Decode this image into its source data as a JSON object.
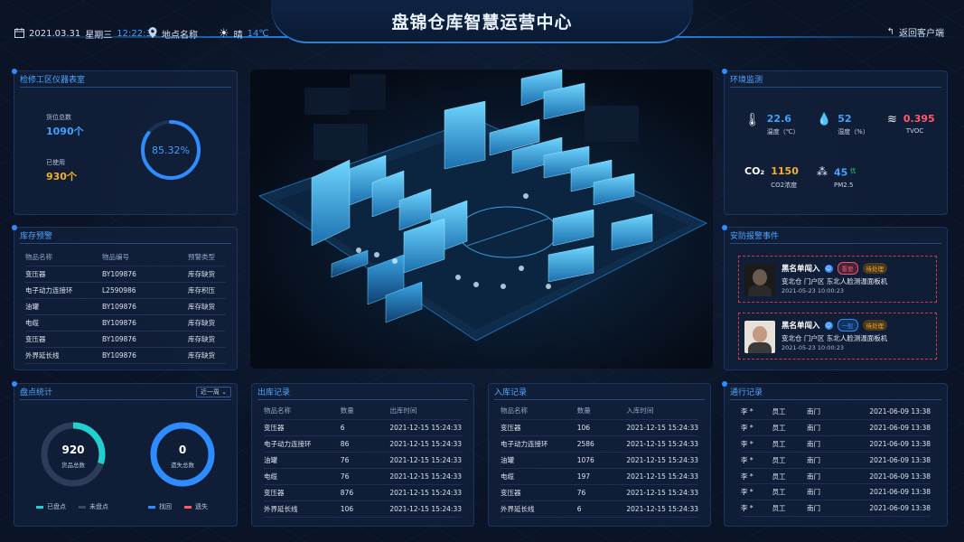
{
  "header": {
    "title": "盘锦仓库智慧运营中心",
    "date": "2021.03.31",
    "weekday": "星期三",
    "time": "12:22:31",
    "location": "地点名称",
    "weather": "晴",
    "temperature": "14℃",
    "back_label": "返回客户端"
  },
  "instrument": {
    "title": "检修工区仪器表室",
    "total_label": "货位总数",
    "total_value": "1090个",
    "used_label": "已使用",
    "used_value": "930个",
    "percent": "85.32%",
    "ratio": 0.8532
  },
  "stock_alert": {
    "title": "库存预警",
    "columns": [
      "物品名称",
      "物品编号",
      "预警类型"
    ],
    "rows": [
      [
        "变压器",
        "BY109876",
        "库存缺货"
      ],
      [
        "电子动力连接环",
        "L2590986",
        "库存积压"
      ],
      [
        "油罐",
        "BY109876",
        "库存缺货"
      ],
      [
        "电缆",
        "BY109876",
        "库存缺货"
      ],
      [
        "变压器",
        "BY109876",
        "库存缺货"
      ],
      [
        "外界延长线",
        "BY109876",
        "库存缺货"
      ]
    ]
  },
  "inventory": {
    "title": "盘点统计",
    "period": "近一周",
    "total": "920",
    "total_label": "货品总数",
    "lost": "0",
    "lost_label": "遗失总数",
    "checked_ratio": 0.3,
    "legend": [
      "已盘点",
      "未盘点",
      "找回",
      "遗失"
    ],
    "colors": [
      "#1fd0cf",
      "#3a4a66",
      "#2f8cff",
      "#ff5a6a"
    ]
  },
  "outbound": {
    "title": "出库记录",
    "columns": [
      "物品名称",
      "数量",
      "出库时间"
    ],
    "rows": [
      [
        "变压器",
        "6",
        "2021-12-15 15:24:33"
      ],
      [
        "电子动力连接环",
        "86",
        "2021-12-15 15:24:33"
      ],
      [
        "油罐",
        "76",
        "2021-12-15 15:24:33"
      ],
      [
        "电缆",
        "76",
        "2021-12-15 15:24:33"
      ],
      [
        "变压器",
        "876",
        "2021-12-15 15:24:33"
      ],
      [
        "外界延长线",
        "106",
        "2021-12-15 15:24:33"
      ]
    ]
  },
  "inbound": {
    "title": "入库记录",
    "columns": [
      "物品名称",
      "数量",
      "入库时间"
    ],
    "rows": [
      [
        "变压器",
        "106",
        "2021-12-15 15:24:33"
      ],
      [
        "电子动力连接环",
        "2586",
        "2021-12-15 15:24:33"
      ],
      [
        "油罐",
        "1076",
        "2021-12-15 15:24:33"
      ],
      [
        "电缆",
        "197",
        "2021-12-15 15:24:33"
      ],
      [
        "变压器",
        "76",
        "2021-12-15 15:24:33"
      ],
      [
        "外界延长线",
        "6",
        "2021-12-15 15:24:33"
      ]
    ]
  },
  "environment": {
    "title": "环境监测",
    "temp": {
      "value": "22.6",
      "label": "温度（℃）"
    },
    "humidity": {
      "value": "52",
      "label": "湿度（%）"
    },
    "tvoc": {
      "value": "0.395",
      "label": "TVOC"
    },
    "co2": {
      "value": "1150",
      "label": "CO2浓度",
      "icon": "CO₂"
    },
    "pm": {
      "value": "45",
      "grade": "优",
      "label": "PM2.5"
    }
  },
  "security": {
    "title": "安防报警事件",
    "events": [
      {
        "title": "黑名单闯入",
        "level": "重要",
        "status": "待处理",
        "desc": "变北仓  门户区  东北人脸测温面板机",
        "time": "2021-05-23 10:00:23",
        "level_color": "#ff4d5e"
      },
      {
        "title": "黑名单闯入",
        "level": "一般",
        "status": "待处理",
        "desc": "变北仓  门户区  东北人脸测温面板机",
        "time": "2021-05-23 10:00:23",
        "level_color": "#2f8cff"
      }
    ]
  },
  "passage": {
    "title": "通行记录",
    "rows": [
      [
        "李 *",
        "员工",
        "南门",
        "2021-06-09 13:38"
      ],
      [
        "李 *",
        "员工",
        "南门",
        "2021-06-09 13:38"
      ],
      [
        "李 *",
        "员工",
        "南门",
        "2021-06-09 13:38"
      ],
      [
        "李 *",
        "员工",
        "南门",
        "2021-06-09 13:38"
      ],
      [
        "李 *",
        "员工",
        "南门",
        "2021-06-09 13:38"
      ],
      [
        "李 *",
        "员工",
        "南门",
        "2021-06-09 13:38"
      ],
      [
        "李 *",
        "员工",
        "南门",
        "2021-06-09 13:38"
      ]
    ]
  }
}
